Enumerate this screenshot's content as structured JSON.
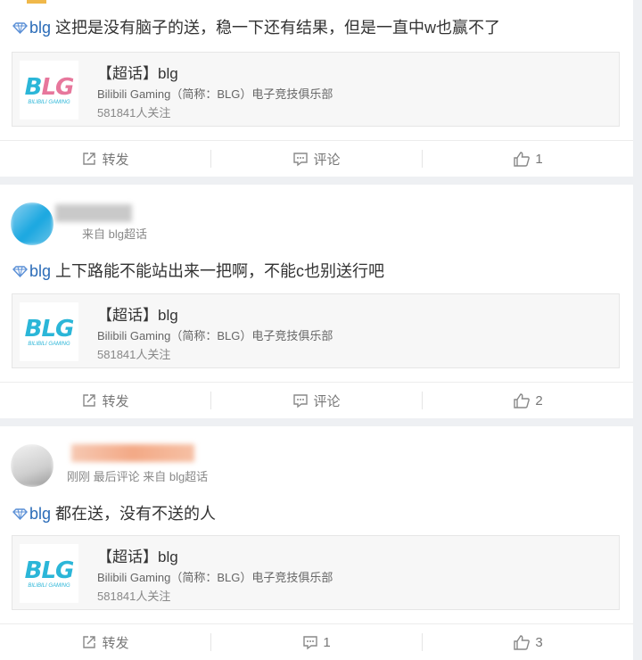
{
  "topic": {
    "title": "【超话】blg",
    "desc": "Bilibili Gaming（简称：BLG）电子竞技俱乐部",
    "followers": "581841人关注",
    "logo_text": "BLG",
    "logo_sub": "BILIBILI GAMING"
  },
  "actions": {
    "repost": "转发",
    "comment": "评论"
  },
  "posts": [
    {
      "tag": "blg",
      "text": "这把是没有脑子的送，稳一下还有结果，但是一直中w也赢不了",
      "comment_label": "评论",
      "likes": "1"
    },
    {
      "meta": "来自 blg超话",
      "tag": "blg",
      "text": "上下路能不能站出来一把啊，不能c也别送行吧",
      "comment_label": "评论",
      "likes": "2"
    },
    {
      "meta": "刚刚 最后评论 来自 blg超话",
      "tag": "blg",
      "text": "都在送，没有不送的人",
      "comment_label": "1",
      "likes": "3"
    }
  ],
  "colors": {
    "accent": "#2b6cb8",
    "logo_pink": "#e7779c",
    "logo_cyan": "#2bb6d8"
  }
}
